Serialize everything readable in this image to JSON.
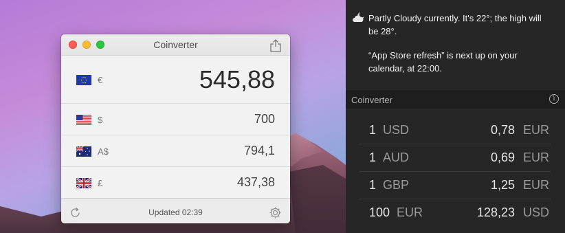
{
  "window": {
    "title": "Coinverter",
    "main": {
      "flag": "eu-flag",
      "symbol": "€",
      "amount": "545,88"
    },
    "rows": [
      {
        "flag": "us-flag",
        "symbol": "$",
        "amount": "700"
      },
      {
        "flag": "au-flag",
        "symbol": "A$",
        "amount": "794,1"
      },
      {
        "flag": "uk-flag",
        "symbol": "£",
        "amount": "437,38"
      }
    ],
    "footer": {
      "updated": "Updated 02:39"
    }
  },
  "notification_center": {
    "weather_icon": "partly-cloudy-night-icon",
    "weather_text": "Partly Cloudy currently. It's 22°; the high will be 28°.",
    "calendar_text": "“App Store refresh” is next up on your calendar, at 22:00.",
    "widget": {
      "title": "Coinverter",
      "rates": [
        {
          "from_amount": "1",
          "from_currency": "USD",
          "to_amount": "0,78",
          "to_currency": "EUR"
        },
        {
          "from_amount": "1",
          "from_currency": "AUD",
          "to_amount": "0,69",
          "to_currency": "EUR"
        },
        {
          "from_amount": "1",
          "from_currency": "GBP",
          "to_amount": "1,25",
          "to_currency": "EUR"
        },
        {
          "from_amount": "100",
          "from_currency": "EUR",
          "to_amount": "128,23",
          "to_currency": "USD"
        }
      ]
    }
  },
  "colors": {
    "close": "#fc5f57",
    "minimize": "#fdbc2e",
    "maximize": "#28c840",
    "panel_bg": "#262626"
  }
}
